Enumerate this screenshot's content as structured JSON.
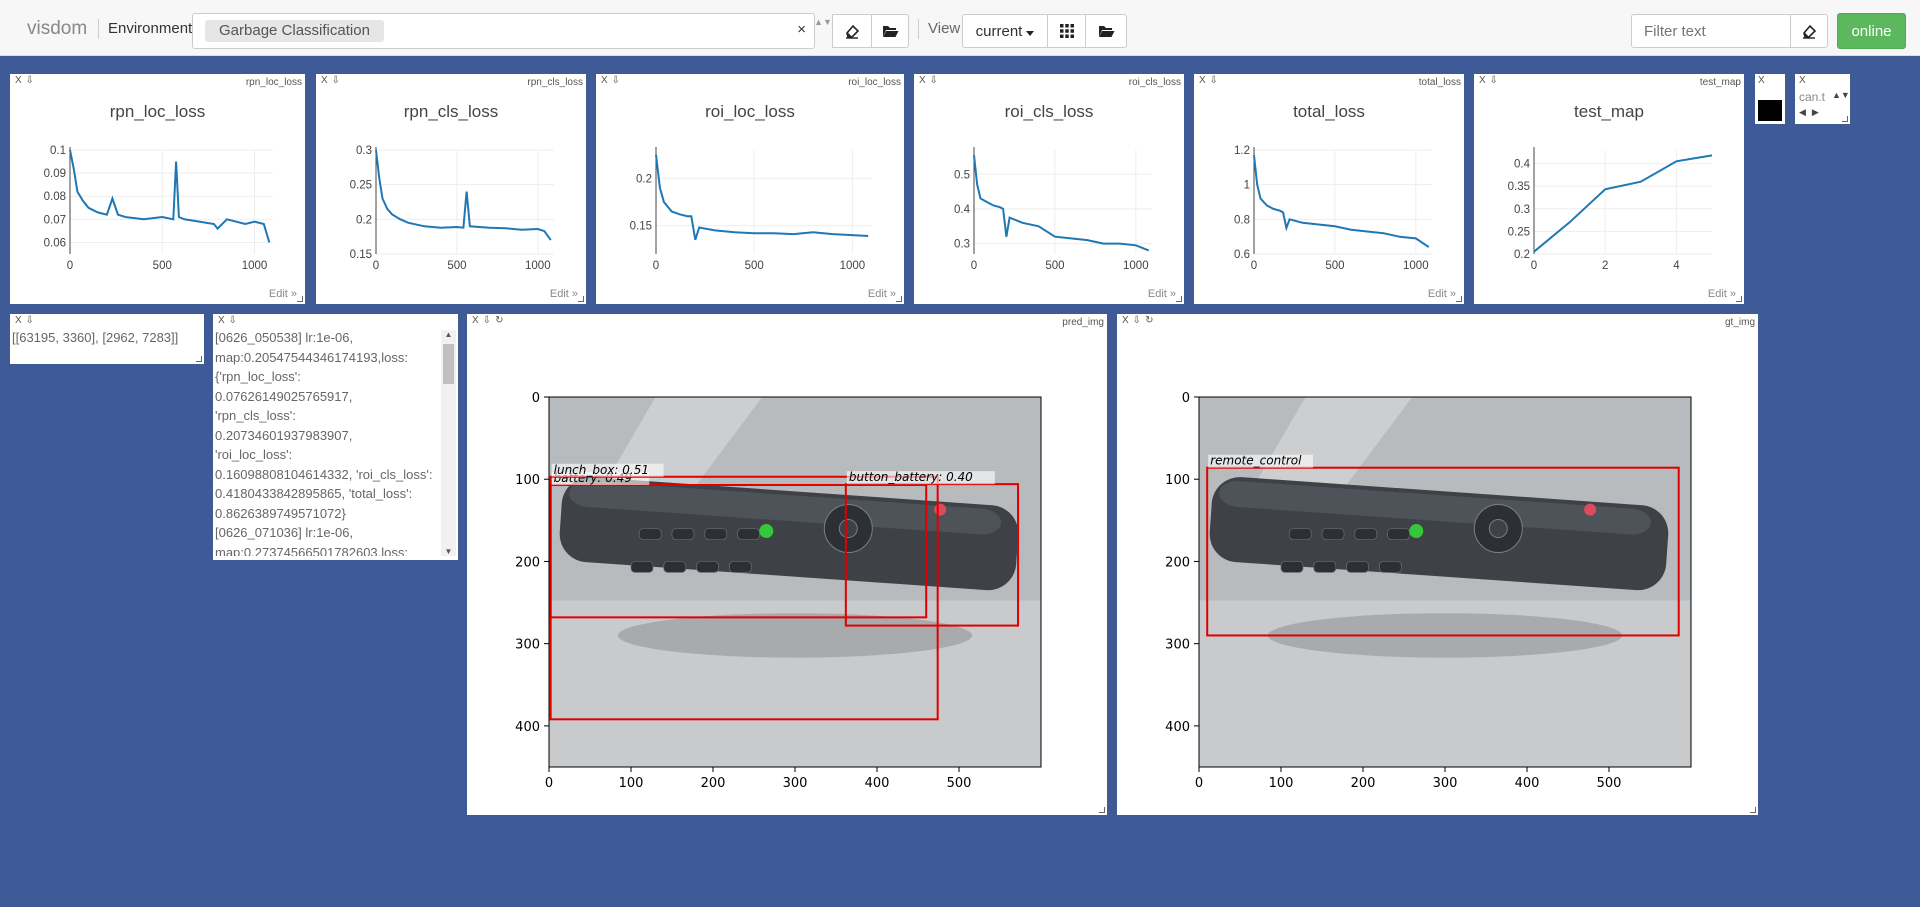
{
  "app": {
    "brand": "visdom",
    "env_label": "Environment",
    "env_chip": "Garbage Classification",
    "env_clear": "×",
    "spinner": "▲▼",
    "view_label": "View",
    "view_value": "current",
    "filter_placeholder": "Filter text",
    "online_label": "online"
  },
  "icons": {
    "eraser": "eraser-icon",
    "folder": "folder-open-icon",
    "grid": "grid-icon"
  },
  "pane_controls": {
    "close": "X",
    "download": "⇩",
    "reset": "↻"
  },
  "plots": [
    {
      "window": "rpn_loc_loss",
      "title": "rpn_loc_loss",
      "edit": "Edit »",
      "ylim": [
        0.055,
        0.1
      ],
      "xlim": [
        0,
        1100
      ],
      "yticks": [
        "0.06",
        "0.07",
        "0.08",
        "0.09",
        "0.1"
      ],
      "xticks": [
        "0",
        "500",
        "1000"
      ],
      "kind": "loss"
    },
    {
      "window": "rpn_cls_loss",
      "title": "rpn_cls_loss",
      "edit": "Edit »",
      "ylim": [
        0.15,
        0.3
      ],
      "xlim": [
        0,
        1100
      ],
      "yticks": [
        "0.15",
        "0.2",
        "0.25",
        "0.3"
      ],
      "xticks": [
        "0",
        "500",
        "1000"
      ],
      "kind": "loss"
    },
    {
      "window": "roi_loc_loss",
      "title": "roi_loc_loss",
      "edit": "Edit »",
      "ylim": [
        0.12,
        0.23
      ],
      "xlim": [
        0,
        1100
      ],
      "yticks": [
        "0.15",
        "0.2"
      ],
      "xticks": [
        "0",
        "500",
        "1000"
      ],
      "kind": "loss"
    },
    {
      "window": "roi_cls_loss",
      "title": "roi_cls_loss",
      "edit": "Edit »",
      "ylim": [
        0.27,
        0.57
      ],
      "xlim": [
        0,
        1100
      ],
      "yticks": [
        "0.3",
        "0.4",
        "0.5"
      ],
      "xticks": [
        "0",
        "500",
        "1000"
      ],
      "kind": "loss"
    },
    {
      "window": "total_loss",
      "title": "total_loss",
      "edit": "Edit »",
      "ylim": [
        0.6,
        1.2
      ],
      "xlim": [
        0,
        1100
      ],
      "yticks": [
        "0.6",
        "0.8",
        "1",
        "1.2"
      ],
      "xticks": [
        "0",
        "500",
        "1000"
      ],
      "kind": "loss"
    },
    {
      "window": "test_map",
      "title": "test_map",
      "edit": "Edit »",
      "ylim": [
        0.2,
        0.43
      ],
      "xlim": [
        0,
        5
      ],
      "yticks": [
        "0.2",
        "0.25",
        "0.3",
        "0.35",
        "0.4"
      ],
      "xticks": [
        "0",
        "2",
        "4"
      ],
      "kind": "map"
    }
  ],
  "chart_data": [
    {
      "type": "line",
      "title": "rpn_loc_loss",
      "x": [
        0,
        20,
        40,
        70,
        100,
        150,
        200,
        230,
        260,
        300,
        400,
        500,
        560,
        575,
        590,
        620,
        700,
        780,
        800,
        850,
        950,
        1000,
        1050,
        1080
      ],
      "y": [
        0.1,
        0.092,
        0.082,
        0.078,
        0.075,
        0.073,
        0.072,
        0.079,
        0.072,
        0.071,
        0.07,
        0.071,
        0.07,
        0.095,
        0.071,
        0.07,
        0.069,
        0.068,
        0.066,
        0.07,
        0.068,
        0.069,
        0.068,
        0.06
      ]
    },
    {
      "type": "line",
      "title": "rpn_cls_loss",
      "x": [
        0,
        20,
        40,
        70,
        100,
        150,
        200,
        300,
        400,
        500,
        540,
        560,
        580,
        700,
        800,
        900,
        1000,
        1040,
        1080
      ],
      "y": [
        0.3,
        0.26,
        0.23,
        0.215,
        0.207,
        0.2,
        0.195,
        0.19,
        0.188,
        0.189,
        0.188,
        0.24,
        0.19,
        0.188,
        0.187,
        0.185,
        0.186,
        0.183,
        0.17
      ]
    },
    {
      "type": "line",
      "title": "roi_loc_loss",
      "x": [
        0,
        20,
        40,
        80,
        120,
        160,
        180,
        200,
        220,
        300,
        400,
        500,
        600,
        700,
        800,
        900,
        1000,
        1080
      ],
      "y": [
        0.225,
        0.19,
        0.175,
        0.165,
        0.162,
        0.16,
        0.16,
        0.135,
        0.148,
        0.145,
        0.143,
        0.142,
        0.142,
        0.141,
        0.143,
        0.141,
        0.14,
        0.139
      ]
    },
    {
      "type": "line",
      "title": "roi_cls_loss",
      "x": [
        0,
        20,
        40,
        80,
        120,
        160,
        180,
        200,
        220,
        300,
        400,
        500,
        600,
        700,
        800,
        900,
        1000,
        1080
      ],
      "y": [
        0.555,
        0.47,
        0.43,
        0.42,
        0.41,
        0.405,
        0.4,
        0.32,
        0.375,
        0.36,
        0.35,
        0.32,
        0.315,
        0.31,
        0.3,
        0.3,
        0.295,
        0.28
      ]
    },
    {
      "type": "line",
      "title": "total_loss",
      "x": [
        0,
        20,
        40,
        80,
        120,
        160,
        180,
        200,
        220,
        300,
        400,
        500,
        600,
        700,
        800,
        900,
        1000,
        1080
      ],
      "y": [
        1.17,
        1.0,
        0.92,
        0.88,
        0.86,
        0.85,
        0.84,
        0.75,
        0.8,
        0.78,
        0.77,
        0.76,
        0.74,
        0.73,
        0.72,
        0.7,
        0.69,
        0.64
      ]
    },
    {
      "type": "line",
      "title": "test_map",
      "x": [
        0,
        1,
        2,
        3,
        4,
        5
      ],
      "y": [
        0.205,
        0.27,
        0.343,
        0.36,
        0.405,
        0.418
      ]
    }
  ],
  "mini_panes": {
    "black_title": "",
    "canvas_text": "can.t"
  },
  "text_panes": {
    "sizes": "[[63195, 3360], [2962, 7283]]",
    "log_lines": [
      "[0626_050538] lr:1e-06,",
      "map:0.20547544346174193,loss:",
      "{'rpn_loc_loss':",
      "0.07626149025765917,",
      "'rpn_cls_loss':",
      "0.20734601937983907,",
      "'roi_loc_loss':",
      "0.16098808104614332, 'roi_cls_loss':",
      "0.4180433842895865, 'total_loss':",
      "0.8626389749571072}",
      "[0626_071036] lr:1e-06,",
      "map:0.27374566501782603,loss:"
    ]
  },
  "images": [
    {
      "window": "pred_img",
      "boxes": [
        {
          "label": "battery: 0.49",
          "color": "#e00000",
          "x1": 2,
          "y1": 107,
          "x2": 460,
          "y2": 268
        },
        {
          "label": "lunch_box: 0.51",
          "color": "#e00000",
          "x1": 2,
          "y1": 97,
          "x2": 474,
          "y2": 392
        },
        {
          "label": "button_battery: 0.40",
          "color": "#e00000",
          "x1": 362,
          "y1": 106,
          "x2": 572,
          "y2": 278
        }
      ]
    },
    {
      "window": "gt_img",
      "boxes": [
        {
          "label": "remote_control",
          "color": "#e00000",
          "x1": 10,
          "y1": 86,
          "x2": 585,
          "y2": 290
        }
      ]
    }
  ],
  "image_axes": {
    "xticks": [
      "0",
      "100",
      "200",
      "300",
      "400",
      "500"
    ],
    "yticks": [
      "0",
      "100",
      "200",
      "300",
      "400"
    ]
  }
}
